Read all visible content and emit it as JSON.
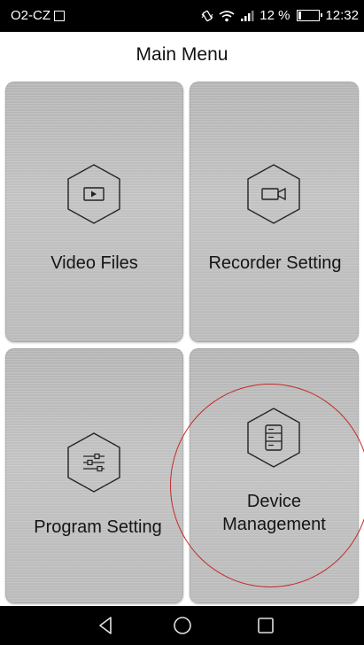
{
  "status_bar": {
    "carrier": "O2-CZ",
    "battery_percent": "12 %",
    "battery_level": 0.12,
    "time": "12:32",
    "icons": [
      "image-icon",
      "vibrate-icon",
      "wifi-icon",
      "signal-icon",
      "battery-icon"
    ]
  },
  "header": {
    "title": "Main Menu"
  },
  "menu": {
    "items": [
      {
        "label": "Video Files",
        "icon": "video-play-icon"
      },
      {
        "label": "Recorder Setting",
        "icon": "camera-icon"
      },
      {
        "label": "Program Setting",
        "icon": "sliders-icon"
      },
      {
        "label": "Device Management",
        "icon": "server-icon"
      }
    ],
    "highlighted_item": "Device Management",
    "highlight_color": "#c62828"
  },
  "nav_bar": {
    "buttons": [
      "back-icon",
      "home-icon",
      "recent-apps-icon"
    ]
  }
}
